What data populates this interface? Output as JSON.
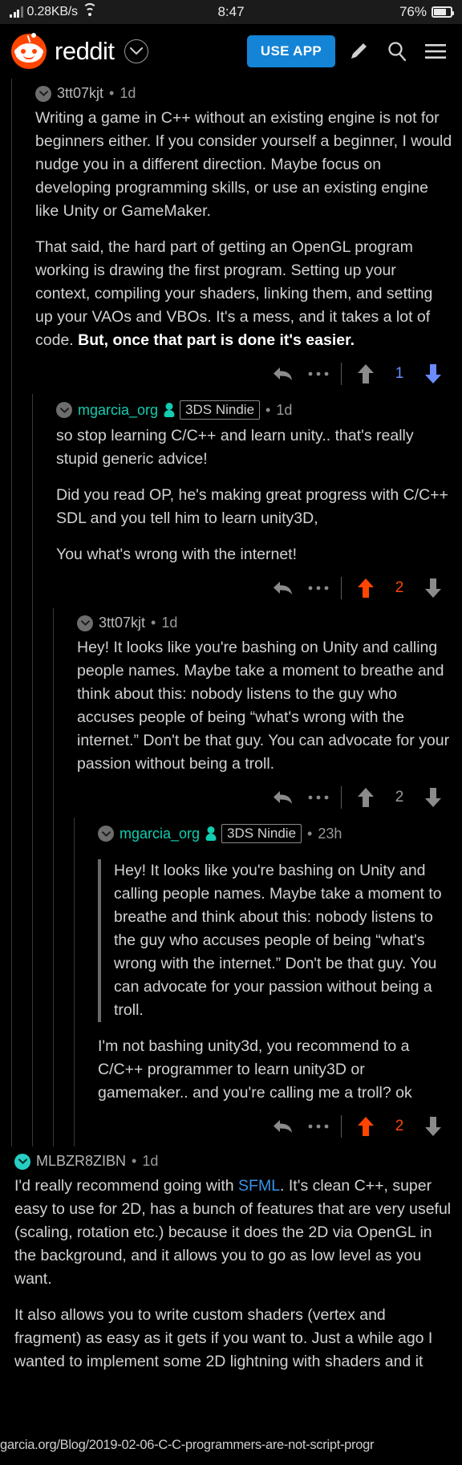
{
  "status_bar": {
    "network_speed": "0.28KB/s",
    "clock": "8:47",
    "battery_percent": "76%",
    "icons": {
      "signal": "signal-bars-icon",
      "wifi": "wifi-icon",
      "battery": "battery-icon"
    }
  },
  "header": {
    "wordmark": "reddit",
    "use_app_label": "USE APP",
    "icons": {
      "logo": "reddit-snoo-logo",
      "dropdown": "chevron-down-icon",
      "compose": "pencil-icon",
      "search": "search-icon",
      "menu": "hamburger-menu-icon"
    }
  },
  "colors": {
    "accent_orange": "#ff4500",
    "downvote_blue": "#6a8cff",
    "link_blue": "#3a93e8",
    "op_teal": "#12cdb0",
    "button_blue": "#1484d7"
  },
  "comments": [
    {
      "id": "c1",
      "depth": 1,
      "author": "3tt07kjt",
      "author_color": "gray",
      "flair": null,
      "age": "1d",
      "paragraphs": [
        "Writing a game in C++ without an existing engine is not for beginners either. If you consider yourself a beginner, I would nudge you in a different direction. Maybe focus on developing programming skills, or use an existing engine like Unity or GameMaker.",
        "That said, the hard part of getting an OpenGL program working is drawing the first program. Setting up your context, compiling your shaders, linking them, and setting up your VAOs and VBOs. It's a mess, and it takes a lot of code. "
      ],
      "bold_tail": "But, once that part is done it's easier.",
      "score": "1",
      "vote_state": "down"
    },
    {
      "id": "c2",
      "depth": 2,
      "author": "mgarcia_org",
      "author_color": "teal",
      "flair": "3DS Nindie",
      "age": "1d",
      "paragraphs": [
        "so stop learning C/C++ and learn unity.. that's really stupid generic advice!",
        "Did you read OP, he's making great progress with C/C++ SDL and you tell him to learn unity3D,",
        "You what's wrong with the internet!"
      ],
      "score": "2",
      "vote_state": "up"
    },
    {
      "id": "c3",
      "depth": 3,
      "author": "3tt07kjt",
      "author_color": "gray",
      "flair": null,
      "age": "1d",
      "paragraphs": [
        "Hey! It looks like you're bashing on Unity and calling people names. Maybe take a moment to breathe and think about this: nobody listens to the guy who accuses people of being “what's wrong with the internet.” Don't be that guy. You can advocate for your passion without being a troll."
      ],
      "score": "2",
      "vote_state": "none"
    },
    {
      "id": "c4",
      "depth": 4,
      "author": "mgarcia_org",
      "author_color": "teal",
      "flair": "3DS Nindie",
      "age": "23h",
      "quote": "Hey! It looks like you're bashing on Unity and calling people names. Maybe take a moment to breathe and think about this: nobody listens to the guy who accuses people of being “what's wrong with the internet.” Don't be that guy. You can advocate for your passion without being a troll.",
      "paragraphs": [
        "I'm not bashing unity3d, you recommend to a C/C++ programmer to learn unity3D or gamemaker.. and you're calling me a troll? ok"
      ],
      "score": "2",
      "vote_state": "up"
    },
    {
      "id": "c5",
      "depth": 0,
      "author": "MLBZR8ZIBN",
      "author_color": "gray",
      "collapse_teal": true,
      "flair": null,
      "age": "1d",
      "paragraph_parts": [
        {
          "text": "I'd really recommend going with "
        },
        {
          "text": "SFML",
          "link": true
        },
        {
          "text": ". It's clean C++, super easy to use for 2D, has a bunch of features that are very useful (scaling, rotation etc.) because it does the 2D via OpenGL in the background, and it allows you to go as low level as you want."
        }
      ],
      "paragraphs_more": [
        "It also allows you to write custom shaders (vertex and fragment) as easy as it gets if you want to. Just a while ago I wanted to implement some 2D lightning with shaders and it"
      ],
      "score": null,
      "vote_state": "none"
    }
  ],
  "action_bar": {
    "reply_icon": "reply-arrow-icon",
    "more_icon": "more-options-icon",
    "upvote_icon": "upvote-arrow-icon",
    "downvote_icon": "downvote-arrow-icon"
  },
  "overlay": {
    "url_text": "garcia.org/Blog/2019-02-06-C-C-programmers-are-not-script-progr"
  }
}
